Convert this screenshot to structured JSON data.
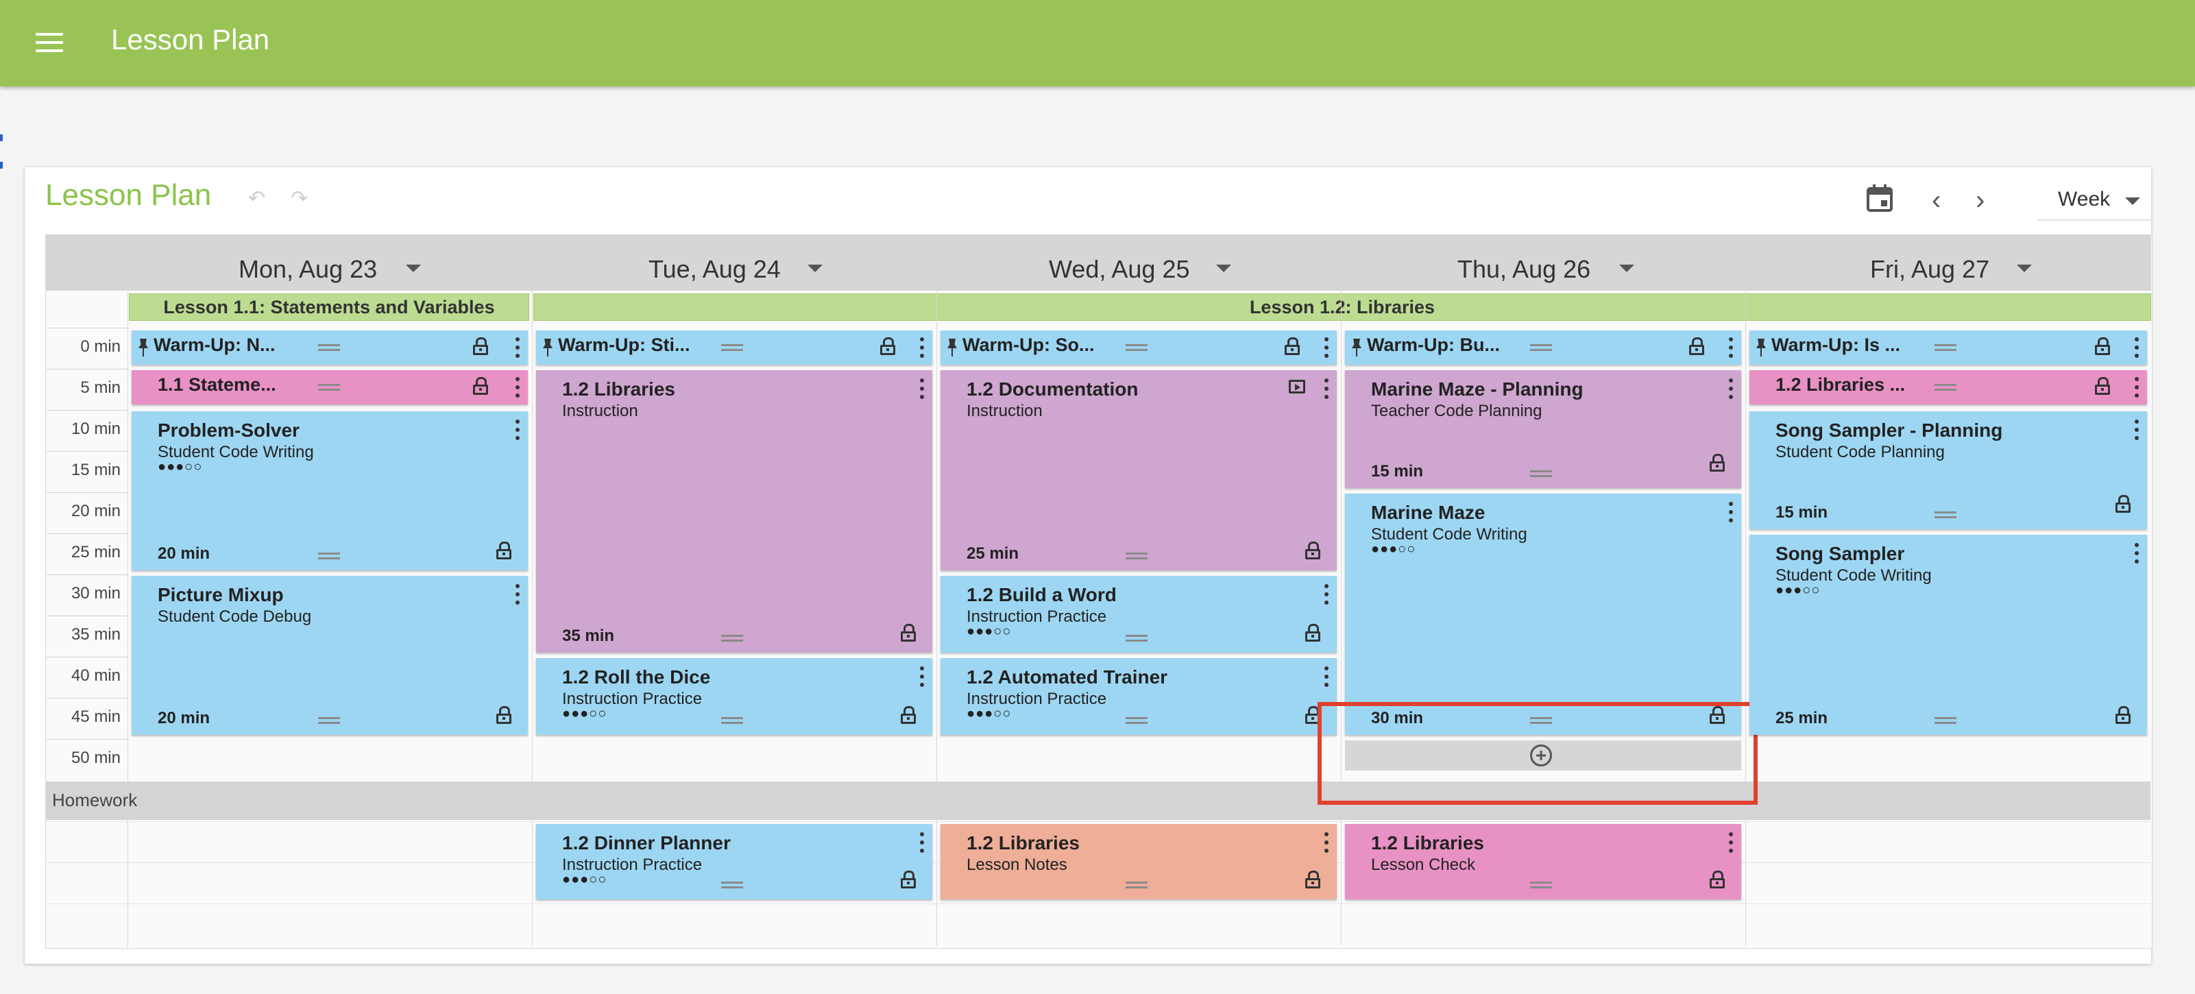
{
  "app": {
    "title": "Lesson Plan"
  },
  "toolbar": {
    "title": "Lesson Plan",
    "undo_icon": "undo-icon",
    "redo_icon": "redo-icon",
    "view": "Week"
  },
  "days": [
    "Mon, Aug 23",
    "Tue, Aug 24",
    "Wed, Aug 25",
    "Thu, Aug 26",
    "Fri, Aug 27"
  ],
  "lessons": [
    "Lesson 1.1: Statements and Variables",
    "Lesson 1.2: Libraries"
  ],
  "time_labels": [
    "0 min",
    "5 min",
    "10 min",
    "15 min",
    "20 min",
    "25 min",
    "30 min",
    "35 min",
    "40 min",
    "45 min",
    "50 min"
  ],
  "homework_label": "Homework",
  "colors": {
    "topbar": "#99c455",
    "blue": "#9dd6f2",
    "pink": "#e891c4",
    "purple": "#cfa6cf",
    "salmon": "#eeae98",
    "lesson_banner": "#bddc91",
    "highlight": "#e0412f"
  },
  "blocks": {
    "mon_warmup": {
      "title": "Warm-Up: N..."
    },
    "mon_stmt": {
      "title": "1.1 Stateme..."
    },
    "mon_ps": {
      "title": "Problem-Solver",
      "subtitle": "Student Code Writing",
      "rating": "●●●○○",
      "duration": "20 min"
    },
    "mon_pm": {
      "title": "Picture Mixup",
      "subtitle": "Student Code Debug",
      "duration": "20 min"
    },
    "tue_warmup": {
      "title": "Warm-Up: Sti..."
    },
    "tue_lib": {
      "title": "1.2 Libraries",
      "subtitle": "Instruction",
      "duration": "35 min"
    },
    "tue_dice": {
      "title": "1.2 Roll the Dice",
      "subtitle": "Instruction Practice",
      "rating": "●●●○○"
    },
    "tue_dinner": {
      "title": "1.2 Dinner Planner",
      "subtitle": "Instruction Practice",
      "rating": "●●●○○"
    },
    "wed_warmup": {
      "title": "Warm-Up: So..."
    },
    "wed_doc": {
      "title": "1.2 Documentation",
      "subtitle": "Instruction",
      "duration": "25 min"
    },
    "wed_word": {
      "title": "1.2 Build a Word",
      "subtitle": "Instruction Practice",
      "rating": "●●●○○"
    },
    "wed_auto": {
      "title": "1.2 Automated Trainer",
      "subtitle": "Instruction Practice",
      "rating": "●●●○○"
    },
    "wed_notes": {
      "title": "1.2 Libraries",
      "subtitle": "Lesson Notes"
    },
    "thu_warmup": {
      "title": "Warm-Up: Bu..."
    },
    "thu_mmp": {
      "title": "Marine Maze - Planning",
      "subtitle": "Teacher Code Planning",
      "duration": "15 min"
    },
    "thu_mm": {
      "title": "Marine Maze",
      "subtitle": "Student Code Writing",
      "rating": "●●●○○",
      "duration": "30 min"
    },
    "thu_check": {
      "title": "1.2 Libraries",
      "subtitle": "Lesson Check"
    },
    "fri_warmup": {
      "title": "Warm-Up: Is ..."
    },
    "fri_lib": {
      "title": "1.2 Libraries ..."
    },
    "fri_ssp": {
      "title": "Song Sampler - Planning",
      "subtitle": "Student Code Planning",
      "duration": "15 min"
    },
    "fri_ss": {
      "title": "Song Sampler",
      "subtitle": "Student Code Writing",
      "rating": "●●●○○",
      "duration": "25 min"
    }
  }
}
